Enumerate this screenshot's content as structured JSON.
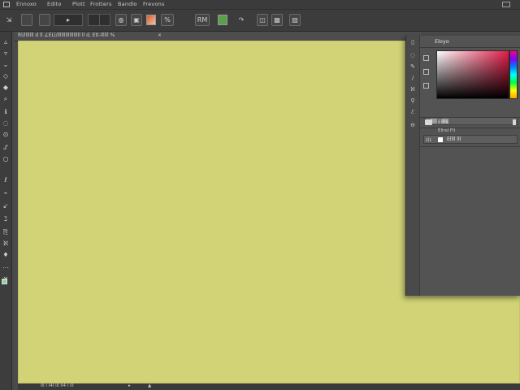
{
  "menubar": {
    "items": [
      "Ennoxo",
      "Edito",
      "Plott",
      "Frotters",
      "Bandlo",
      "Frevons"
    ],
    "icons": {
      "app": "app-logo-icon",
      "window": "window-restore-icon"
    }
  },
  "optionsbar": {
    "tool_icons": [
      "move-icon",
      "rectangle-icon",
      "marquee-icon",
      "dropdown-icon",
      "lasso-icon",
      "brush-icon",
      "stamp-icon",
      "gradient-swatch-icon",
      "image-icon",
      "ellipse-icon",
      "layer-green-icon",
      "path-icon",
      "crop-icon",
      "photo-icon"
    ],
    "labels": {
      "arrow": "▸",
      "pct": "%",
      "rm": "RM"
    }
  },
  "document": {
    "tab_label": "Rl/lllllll d ll ∠ELl/lllllllllllllllll ll d, Etl-llllll %",
    "close": "×"
  },
  "toolbox": {
    "tools": [
      "▵",
      "▿",
      "⌄",
      "◇",
      "◆",
      "⌕",
      "ℹ",
      "◌",
      "⊙",
      "ᔑ",
      "○",
      "ℓ",
      "⌁",
      "↙",
      "ℷ",
      "⎘",
      "ℵ",
      "♦",
      "⋯",
      "✕",
      ""
    ],
    "active_color": "#8fd3a0"
  },
  "canvas": {
    "background_color": "#d1d376"
  },
  "statusbar": {
    "text": "Ill l l4I lll ll4 l lll",
    "arrow": "▸",
    "info": "▲"
  },
  "color_panel": {
    "title": "Eloyo",
    "hue_start": "#e11d48",
    "layers_section_label": "Ellrs",
    "layers_header": "Ellrsl Fll",
    "layer_row_name": "Ellll lll",
    "layer_row_eye": "ɪ(ɪ"
  }
}
